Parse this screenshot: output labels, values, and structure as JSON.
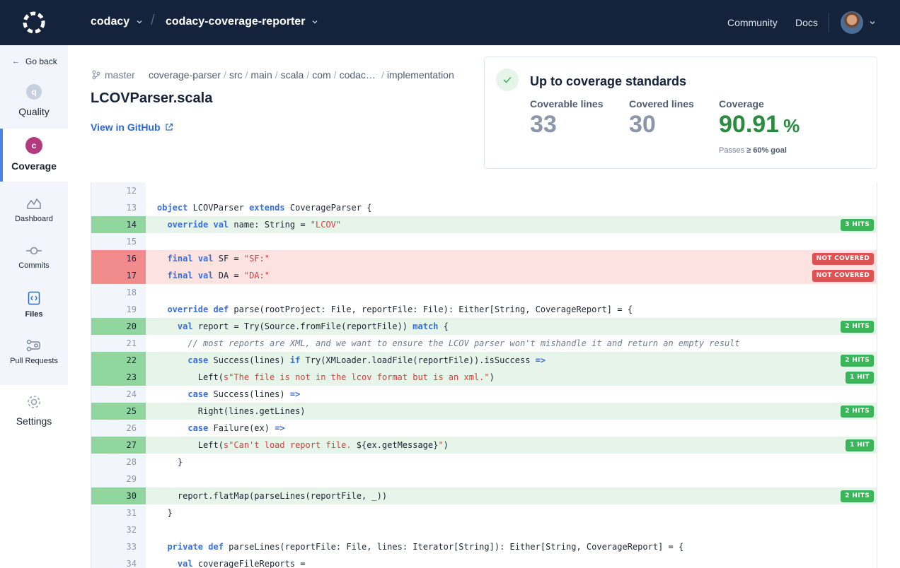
{
  "topbar": {
    "org": "codacy",
    "repo": "codacy-coverage-reporter",
    "nav": {
      "community": "Community",
      "docs": "Docs"
    }
  },
  "sidebar": {
    "go_back": "Go back",
    "items": [
      {
        "label": "Quality",
        "icon": "quality-icon",
        "badge": "q"
      },
      {
        "label": "Coverage",
        "icon": "coverage-icon",
        "badge": "c",
        "active": true
      },
      {
        "label": "Dashboard",
        "icon": "dashboard-icon"
      },
      {
        "label": "Commits",
        "icon": "commits-icon"
      },
      {
        "label": "Files",
        "icon": "files-icon"
      },
      {
        "label": "Pull Requests",
        "icon": "pull-requests-icon"
      },
      {
        "label": "Settings",
        "icon": "gear-icon"
      }
    ]
  },
  "file": {
    "branch": "master",
    "path": [
      "coverage-parser",
      "src",
      "main",
      "scala",
      "com",
      "codac…",
      "implementation"
    ],
    "name": "LCOVParser.scala",
    "github_link": "View in GitHub"
  },
  "coverage": {
    "title": "Up to coverage standards",
    "coverable_label": "Coverable lines",
    "coverable": "33",
    "covered_label": "Covered lines",
    "covered": "30",
    "coverage_label": "Coverage",
    "coverage_value": "90.91",
    "coverage_unit": "%",
    "goal_prefix": "Passes",
    "goal_value": "≥ 60% goal"
  },
  "colors": {
    "topbar": "#15223b",
    "accent": "#4b83e9",
    "covered": "#8fd79e",
    "not_covered": "#f28c8c",
    "coverage_green": "#2a8a3e"
  },
  "code_lines": [
    {
      "n": "12",
      "status": "none",
      "text": ""
    },
    {
      "n": "13",
      "status": "none",
      "text": "object LCOVParser extends CoverageParser {"
    },
    {
      "n": "14",
      "status": "covered",
      "text": "  override val name: String = \"LCOV\"",
      "badge": "3 HITS"
    },
    {
      "n": "15",
      "status": "none",
      "text": ""
    },
    {
      "n": "16",
      "status": "not_covered",
      "text": "  final val SF = \"SF:\"",
      "badge": "NOT COVERED"
    },
    {
      "n": "17",
      "status": "not_covered",
      "text": "  final val DA = \"DA:\"",
      "badge": "NOT COVERED"
    },
    {
      "n": "18",
      "status": "none",
      "text": ""
    },
    {
      "n": "19",
      "status": "none",
      "text": "  override def parse(rootProject: File, reportFile: File): Either[String, CoverageReport] = {"
    },
    {
      "n": "20",
      "status": "covered",
      "text": "    val report = Try(Source.fromFile(reportFile)) match {",
      "badge": "2 HITS"
    },
    {
      "n": "21",
      "status": "none",
      "text": "      // most reports are XML, and we want to ensure the LCOV parser won't mishandle it and return an empty result"
    },
    {
      "n": "22",
      "status": "covered",
      "text": "      case Success(lines) if Try(XMLoader.loadFile(reportFile)).isSuccess =>",
      "badge": "2 HITS"
    },
    {
      "n": "23",
      "status": "covered",
      "text": "        Left(s\"The file is not in the lcov format but is an xml.\")",
      "badge": "1 HIT"
    },
    {
      "n": "24",
      "status": "none",
      "text": "      case Success(lines) =>"
    },
    {
      "n": "25",
      "status": "covered",
      "text": "        Right(lines.getLines)",
      "badge": "2 HITS"
    },
    {
      "n": "26",
      "status": "none",
      "text": "      case Failure(ex) =>"
    },
    {
      "n": "27",
      "status": "covered",
      "text": "        Left(s\"Can't load report file. ${ex.getMessage}\")",
      "badge": "1 HIT"
    },
    {
      "n": "28",
      "status": "none",
      "text": "    }"
    },
    {
      "n": "29",
      "status": "none",
      "text": ""
    },
    {
      "n": "30",
      "status": "covered",
      "text": "    report.flatMap(parseLines(reportFile, _))",
      "badge": "2 HITS"
    },
    {
      "n": "31",
      "status": "none",
      "text": "  }"
    },
    {
      "n": "32",
      "status": "none",
      "text": ""
    },
    {
      "n": "33",
      "status": "none",
      "text": "  private def parseLines(reportFile: File, lines: Iterator[String]): Either[String, CoverageReport] = {"
    },
    {
      "n": "34",
      "status": "none",
      "text": "    val coverageFileReports ="
    }
  ]
}
